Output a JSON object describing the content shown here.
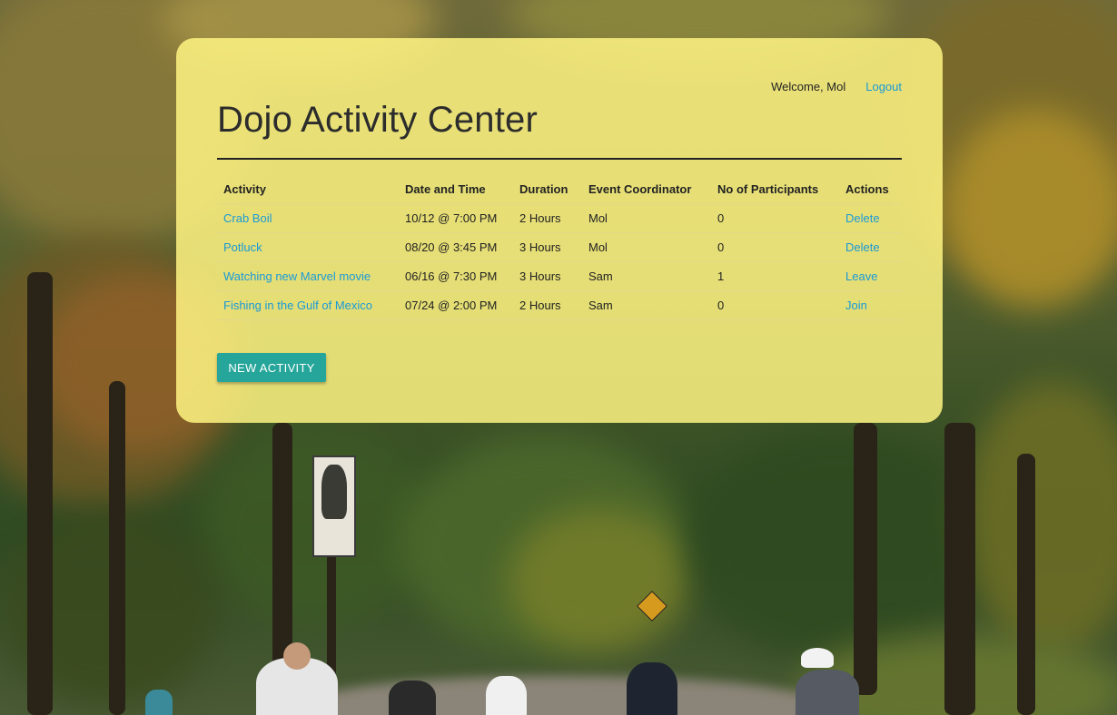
{
  "header": {
    "welcome_text": "Welcome, Mol",
    "logout_label": "Logout",
    "title": "Dojo Activity Center"
  },
  "table": {
    "columns": [
      "Activity",
      "Date and Time",
      "Duration",
      "Event Coordinator",
      "No of Participants",
      "Actions"
    ],
    "rows": [
      {
        "activity": "Crab Boil",
        "datetime": "10/12 @ 7:00 PM",
        "duration": "2 Hours",
        "coordinator": "Mol",
        "participants": "0",
        "action": "Delete"
      },
      {
        "activity": "Potluck",
        "datetime": "08/20 @ 3:45 PM",
        "duration": "3 Hours",
        "coordinator": "Mol",
        "participants": "0",
        "action": "Delete"
      },
      {
        "activity": "Watching new Marvel movie",
        "datetime": "06/16 @ 7:30 PM",
        "duration": "3 Hours",
        "coordinator": "Sam",
        "participants": "1",
        "action": "Leave"
      },
      {
        "activity": "Fishing in the Gulf of Mexico",
        "datetime": "07/24 @ 2:00 PM",
        "duration": "2 Hours",
        "coordinator": "Sam",
        "participants": "0",
        "action": "Join"
      }
    ]
  },
  "new_activity_label": "NEW ACTIVITY",
  "colors": {
    "panel": "#fff582",
    "link": "#1a9ad6",
    "button": "#26a69a"
  }
}
